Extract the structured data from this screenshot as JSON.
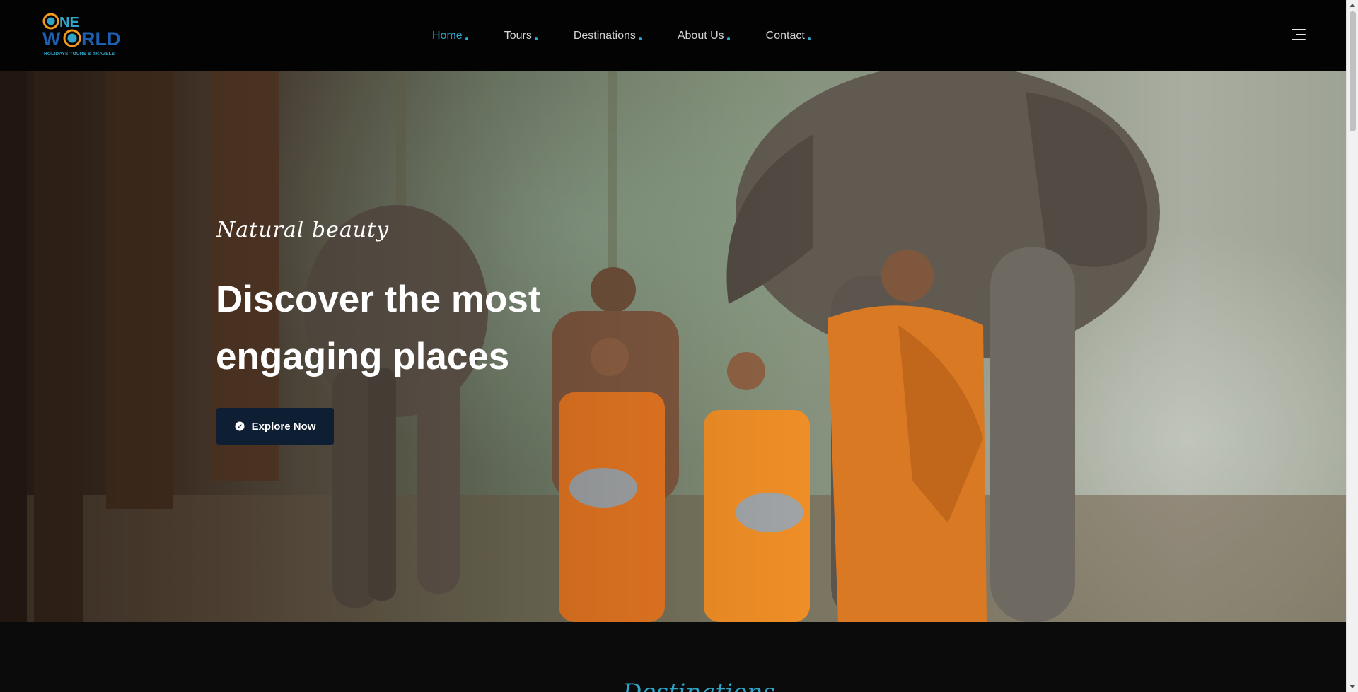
{
  "brand": {
    "logo_alt": "One World Holidays Tours & Travels logo",
    "line1": "ONE",
    "line2": "WORLD",
    "tagline": "HOLIDAYS TOURS & TRAVELS",
    "colors": {
      "blue": "#1d5fb0",
      "teal": "#2fa6c9",
      "orange": "#f29a1f"
    }
  },
  "nav": {
    "items": [
      {
        "label": "Home",
        "active": true
      },
      {
        "label": "Tours",
        "active": false
      },
      {
        "label": "Destinations",
        "active": false
      },
      {
        "label": "About Us",
        "active": false
      },
      {
        "label": "Contact",
        "active": false
      }
    ],
    "menu_icon": "hamburger-menu-icon"
  },
  "hero": {
    "subtitle": "Natural beauty",
    "title": "Discover the most engaging places",
    "cta_label": "Explore Now",
    "cta_icon": "compass-icon",
    "image_description_icon": "hero-photo"
  },
  "next_section": {
    "script_heading": "Destinations"
  },
  "theme": {
    "accent": "#2fa6c9",
    "header_bg": "#030303",
    "button_bg": "#0f1f33"
  }
}
